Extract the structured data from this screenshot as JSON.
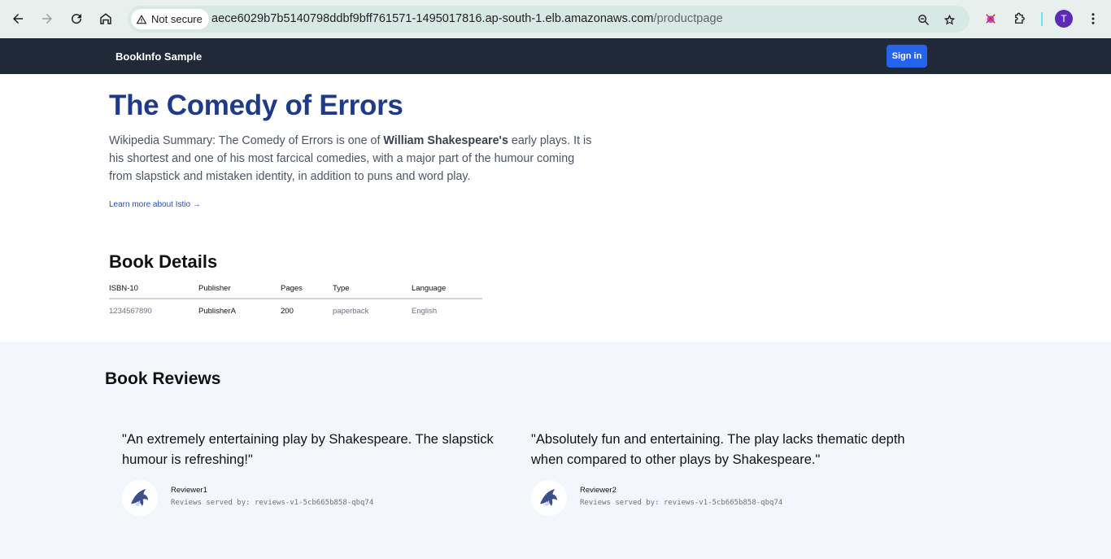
{
  "browser": {
    "security_label": "Not secure",
    "url_host": "aece6029b7b5140798ddbf9bff761571-1495017816.ap-south-1.elb.amazonaws.com",
    "url_path": "/productpage",
    "avatar_initial": "T"
  },
  "appbar": {
    "brand": "BookInfo Sample",
    "signin_label": "Sign in"
  },
  "product": {
    "title": "The Comedy of Errors",
    "summary_prefix": "Wikipedia Summary: The Comedy of Errors is one of ",
    "summary_bold": "William Shakespeare's",
    "summary_suffix": " early plays. It is his shortest and one of his most farcical comedies, with a major part of the humour coming from slapstick and mistaken identity, in addition to puns and word play.",
    "learn_more": "Learn more about Istio →"
  },
  "details": {
    "heading": "Book Details",
    "columns": [
      "ISBN-10",
      "Publisher",
      "Pages",
      "Type",
      "Language"
    ],
    "row": [
      "1234567890",
      "PublisherA",
      "200",
      "paperback",
      "English"
    ]
  },
  "reviews": {
    "heading": "Book Reviews",
    "items": [
      {
        "quote": "\"An extremely entertaining play by Shakespeare. The slapstick humour is refreshing!\"",
        "reviewer": "Reviewer1",
        "served_by": "Reviews served by: reviews-v1-5cb665b858-qbq74"
      },
      {
        "quote": "\"Absolutely fun and entertaining. The play lacks thematic depth when compared to other plays by Shakespeare.\"",
        "reviewer": "Reviewer2",
        "served_by": "Reviews served by: reviews-v1-5cb665b858-qbq74"
      }
    ]
  }
}
